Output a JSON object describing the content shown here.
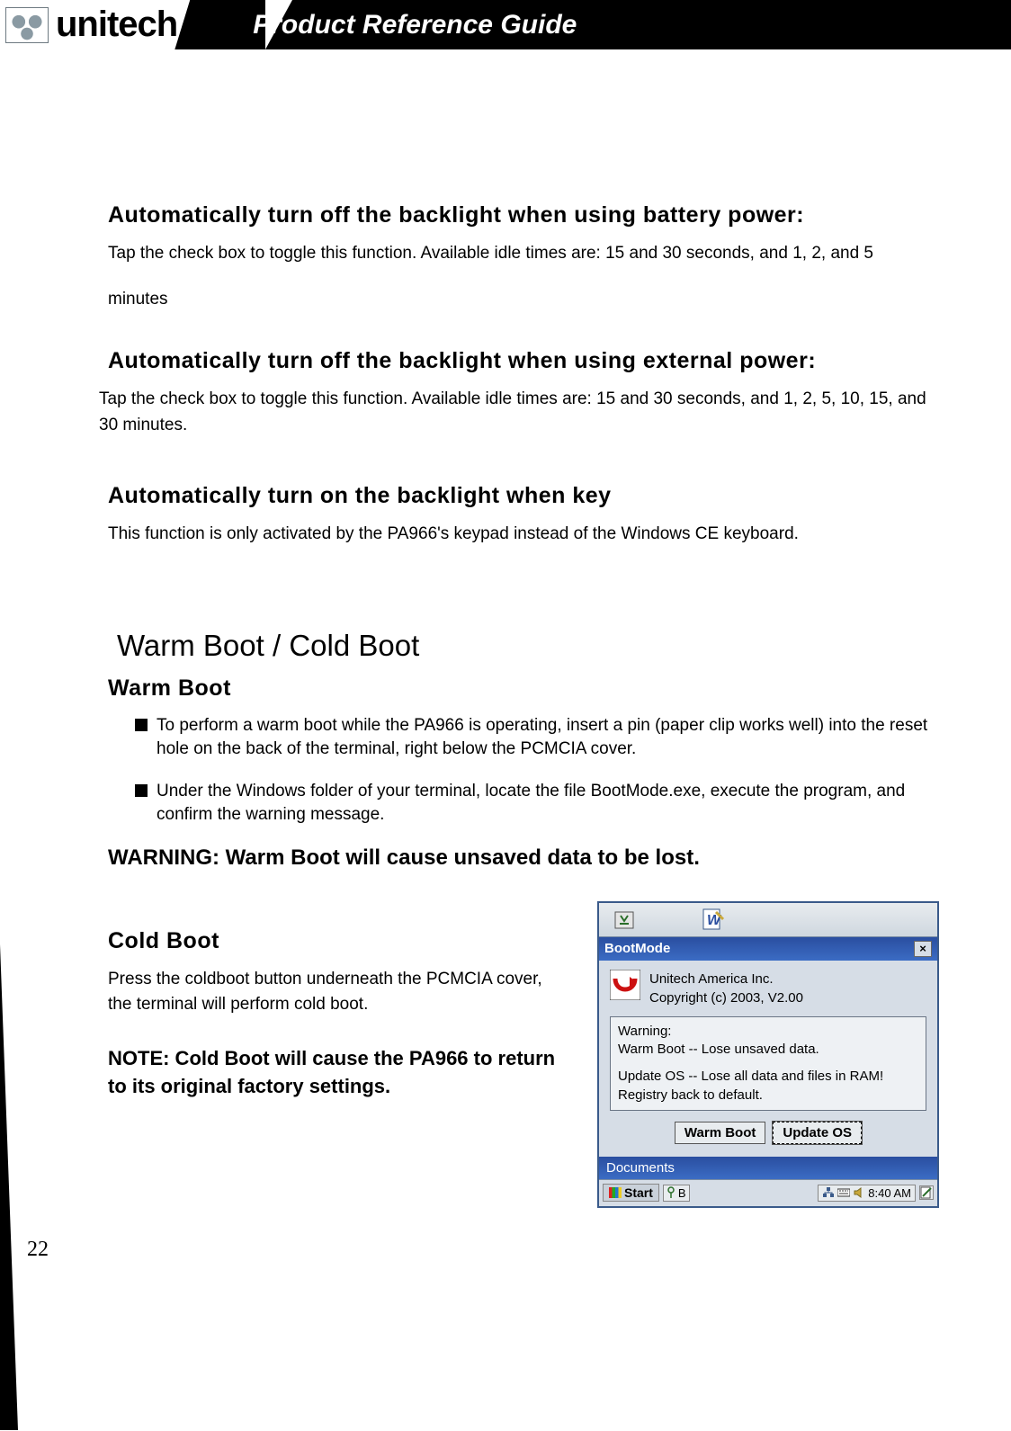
{
  "header": {
    "brand": "unitech",
    "title": "Product Reference Guide"
  },
  "page_number": "22",
  "sections": {
    "s1": {
      "heading": "Automatically turn off the backlight when using battery power:",
      "text_a": "Tap the check box to toggle this function.  Available idle times are: 15 and 30 seconds, and 1, 2, and 5",
      "text_b": "minutes"
    },
    "s2": {
      "heading": "Automatically turn off the backlight when using external power:",
      "text": "Tap the check box to toggle this function.  Available idle times are:  15 and 30 seconds, and 1, 2, 5, 10, 15, and 30 minutes."
    },
    "s3": {
      "heading": "Automatically turn on the backlight when key",
      "text": "This function is only activated by the PA966's keypad instead of the Windows CE keyboard."
    },
    "boot": {
      "section_title": "Warm Boot / Cold Boot",
      "warm_heading": "Warm Boot",
      "bullet1": "To perform a warm boot while the PA966 is operating, insert a pin (paper clip works well) into the reset hole on the back of the terminal, right below the PCMCIA cover.",
      "bullet2": "Under the Windows folder of your terminal, locate the file BootMode.exe, execute the program, and confirm the warning message.",
      "warning": "WARNING:  Warm Boot will cause unsaved data to be lost.",
      "cold_heading": "Cold Boot",
      "cold_text": "Press the coldboot button underneath the PCMCIA cover, the terminal will perform cold boot.",
      "note": "NOTE:  Cold Boot will cause the PA966 to return to its original factory settings."
    }
  },
  "bootmode_window": {
    "title": "BootMode",
    "about_line1": "Unitech America Inc.",
    "about_line2": "Copyright (c) 2003, V2.00",
    "warn_label": "Warning:",
    "warn_line1": "Warm Boot -- Lose unsaved data.",
    "warn_line2": "Update OS -- Lose all data and files in RAM! Registry back to default.",
    "btn_warm": "Warm Boot",
    "btn_update": "Update OS",
    "documents": "Documents",
    "start": "Start",
    "ime_letter": "B",
    "time": "8:40 AM"
  }
}
